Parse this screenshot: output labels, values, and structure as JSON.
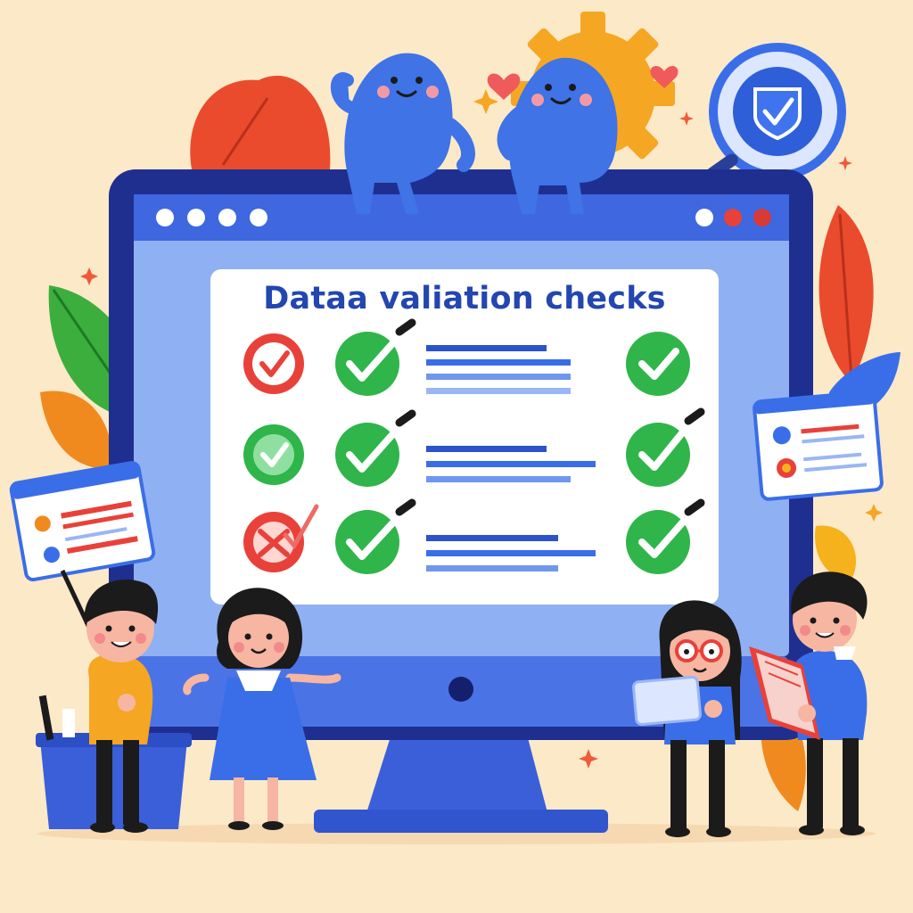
{
  "screen": {
    "title": "Dataa valiation checks"
  },
  "colors": {
    "background": "#fbe9c8",
    "monitor_frame": "#1f2f8f",
    "monitor_screen": "#8fb0f2",
    "monitor_base": "#3b5fd8",
    "panel": "#ffffff",
    "accent_blue": "#3a6ee8",
    "check_green": "#2fb54a",
    "error_red": "#e8413a",
    "leaf_red": "#ea4b2d",
    "leaf_green": "#3cae3d",
    "leaf_orange": "#f08a1f"
  },
  "checklist": [
    {
      "left_status": "red-check-icon",
      "middle_status": "green-check-icon",
      "right_status": "green-check-icon"
    },
    {
      "left_status": "green-check-icon",
      "middle_status": "green-check-icon",
      "right_status": "green-check-icon"
    },
    {
      "left_status": "red-cross-check-icon",
      "middle_status": "green-check-icon",
      "right_status": "green-check-icon"
    }
  ],
  "icons": {
    "badge": "shield-check-icon",
    "gear": "gear-icon",
    "hearts": "heart-icon",
    "sparkles": "sparkle-icon"
  }
}
